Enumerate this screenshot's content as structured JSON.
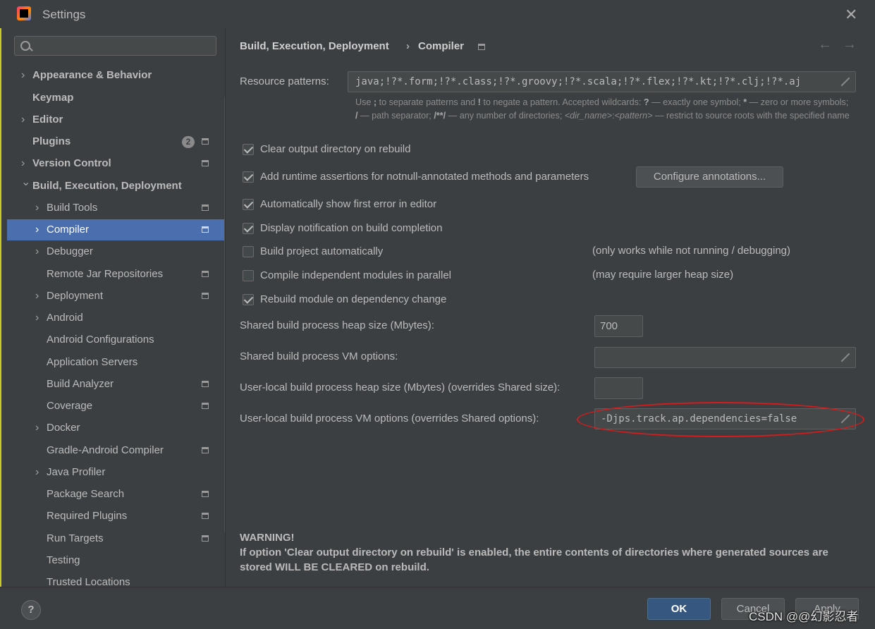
{
  "window": {
    "title": "Settings",
    "close_glyph": "✕"
  },
  "search": {
    "placeholder": "",
    "value": ""
  },
  "sidebar": {
    "items": [
      {
        "label": "Appearance & Behavior",
        "bold": true,
        "expandable": true,
        "level": 0,
        "project_icon": false
      },
      {
        "label": "Keymap",
        "bold": true,
        "expandable": false,
        "level": 0,
        "project_icon": false
      },
      {
        "label": "Editor",
        "bold": true,
        "expandable": true,
        "level": 0,
        "project_icon": false
      },
      {
        "label": "Plugins",
        "bold": true,
        "expandable": false,
        "level": 0,
        "project_icon": true,
        "badge": "2"
      },
      {
        "label": "Version Control",
        "bold": true,
        "expandable": true,
        "level": 0,
        "project_icon": true
      },
      {
        "label": "Build, Execution, Deployment",
        "bold": true,
        "expandable": true,
        "expanded": true,
        "level": 0,
        "project_icon": false
      },
      {
        "label": "Build Tools",
        "expandable": true,
        "level": 1,
        "project_icon": true
      },
      {
        "label": "Compiler",
        "expandable": true,
        "level": 1,
        "project_icon": true,
        "selected": true
      },
      {
        "label": "Debugger",
        "expandable": true,
        "level": 1,
        "project_icon": false
      },
      {
        "label": "Remote Jar Repositories",
        "expandable": false,
        "level": 1,
        "project_icon": true
      },
      {
        "label": "Deployment",
        "expandable": true,
        "level": 1,
        "project_icon": true
      },
      {
        "label": "Android",
        "expandable": true,
        "level": 1,
        "project_icon": false
      },
      {
        "label": "Android Configurations",
        "expandable": false,
        "level": 1,
        "project_icon": false
      },
      {
        "label": "Application Servers",
        "expandable": false,
        "level": 1,
        "project_icon": false
      },
      {
        "label": "Build Analyzer",
        "expandable": false,
        "level": 1,
        "project_icon": true
      },
      {
        "label": "Coverage",
        "expandable": false,
        "level": 1,
        "project_icon": true
      },
      {
        "label": "Docker",
        "expandable": true,
        "level": 1,
        "project_icon": false
      },
      {
        "label": "Gradle-Android Compiler",
        "expandable": false,
        "level": 1,
        "project_icon": true
      },
      {
        "label": "Java Profiler",
        "expandable": true,
        "level": 1,
        "project_icon": false
      },
      {
        "label": "Package Search",
        "expandable": false,
        "level": 1,
        "project_icon": true
      },
      {
        "label": "Required Plugins",
        "expandable": false,
        "level": 1,
        "project_icon": true
      },
      {
        "label": "Run Targets",
        "expandable": false,
        "level": 1,
        "project_icon": true
      },
      {
        "label": "Testing",
        "expandable": false,
        "level": 1,
        "project_icon": false
      },
      {
        "label": "Trusted Locations",
        "expandable": false,
        "level": 1,
        "project_icon": false
      }
    ]
  },
  "breadcrumb": {
    "parent": "Build, Execution, Deployment",
    "separator": "›",
    "current": "Compiler",
    "back": "←",
    "forward": "→"
  },
  "resource_patterns": {
    "label": "Resource patterns:",
    "value": "java;!?*.form;!?*.class;!?*.groovy;!?*.scala;!?*.flex;!?*.kt;!?*.clj;!?*.aj",
    "hint": {
      "p1": "Use ",
      "b1": ";",
      "p2": " to separate patterns and ",
      "b2": "!",
      "p3": " to negate a pattern. Accepted wildcards: ",
      "b3": "?",
      "p4": " — exactly one symbol; ",
      "b4": "*",
      "p5": " — zero or more symbols; ",
      "b5": "/",
      "p6": " — path separator; ",
      "b6": "/**/",
      "p7": " — any number of directories; ",
      "i1": "<dir_name>",
      "p8": ":",
      "i2": "<pattern>",
      "p9": " — restrict to source roots with the specified name"
    }
  },
  "options": [
    {
      "label": "Clear output directory on rebuild",
      "checked": true
    },
    {
      "label": "Add runtime assertions for notnull-annotated methods and parameters",
      "checked": true
    },
    {
      "label": "Automatically show first error in editor",
      "checked": true
    },
    {
      "label": "Display notification on build completion",
      "checked": true
    },
    {
      "label": "Build project automatically",
      "checked": false,
      "note": "(only works while not running / debugging)"
    },
    {
      "label": "Compile independent modules in parallel",
      "checked": false,
      "note": "(may require larger heap size)"
    },
    {
      "label": "Rebuild module on dependency change",
      "checked": true
    }
  ],
  "configure_annotations": {
    "label": "Configure annotations..."
  },
  "fields": {
    "shared_heap": {
      "label": "Shared build process heap size (Mbytes):",
      "value": "700"
    },
    "shared_vm": {
      "label": "Shared build process VM options:",
      "value": ""
    },
    "user_heap": {
      "label": "User-local build process heap size (Mbytes) (overrides Shared size):",
      "value": ""
    },
    "user_vm": {
      "label": "User-local build process VM options (overrides Shared options):",
      "value": "-Djps.track.ap.dependencies=false"
    }
  },
  "warning": {
    "title": "WARNING!",
    "body": "If option 'Clear output directory on rebuild' is enabled, the entire contents of directories where generated sources are stored WILL BE CLEARED on rebuild."
  },
  "footer": {
    "ok": "OK",
    "cancel": "Cancel",
    "apply": "Apply",
    "help": "?"
  },
  "watermark": "CSDN @@幻影忍者",
  "colors": {
    "selection": "#4b6eaf",
    "background": "#3c3f41",
    "callout": "#d41c1c",
    "primary_button": "#365880"
  }
}
